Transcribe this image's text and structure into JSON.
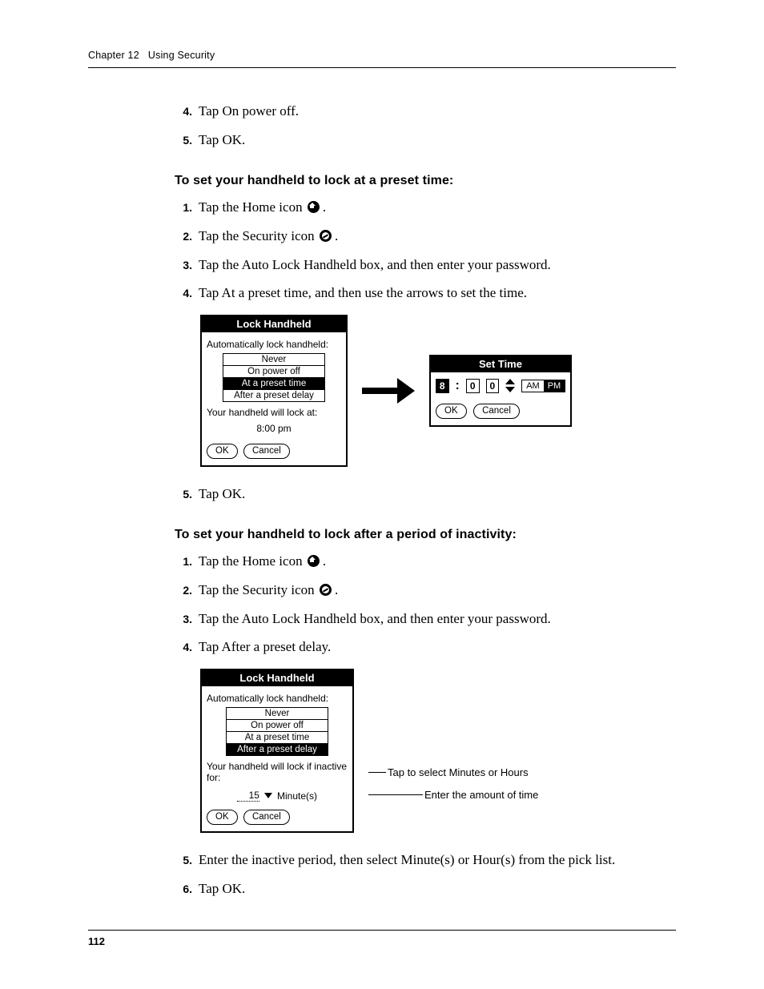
{
  "header": {
    "chapter": "Chapter 12",
    "title": "Using Security"
  },
  "page_number": "112",
  "intro_steps": [
    {
      "n": "4.",
      "t": "Tap On power off."
    },
    {
      "n": "5.",
      "t": "Tap OK."
    }
  ],
  "sectionA": {
    "heading": "To set your handheld to lock at a preset time:",
    "steps": [
      {
        "n": "1.",
        "pre": "Tap the Home icon ",
        "post": ".",
        "icon": "home"
      },
      {
        "n": "2.",
        "pre": "Tap the Security icon ",
        "post": ".",
        "icon": "security"
      },
      {
        "n": "3.",
        "t": "Tap the Auto Lock Handheld box, and then enter your password."
      },
      {
        "n": "4.",
        "t": "Tap At a preset time, and then use the arrows to set the time."
      }
    ],
    "figure": {
      "lock": {
        "title": "Lock Handheld",
        "label": "Automatically lock handheld:",
        "options": [
          "Never",
          "On power off",
          "At a preset time",
          "After a preset delay"
        ],
        "selected": "At a preset time",
        "lockat_label": "Your handheld will lock at:",
        "lockat_time": "8:00 pm",
        "ok": "OK",
        "cancel": "Cancel"
      },
      "settime": {
        "title": "Set Time",
        "hour": "8",
        "m1": "0",
        "m2": "0",
        "am": "AM",
        "pm": "PM",
        "ok": "OK",
        "cancel": "Cancel"
      }
    },
    "after_step": {
      "n": "5.",
      "t": "Tap OK."
    }
  },
  "sectionB": {
    "heading": "To set your handheld to lock after a period of inactivity:",
    "steps": [
      {
        "n": "1.",
        "pre": "Tap the Home icon ",
        "post": ".",
        "icon": "home"
      },
      {
        "n": "2.",
        "pre": "Tap the Security icon ",
        "post": ".",
        "icon": "security"
      },
      {
        "n": "3.",
        "t": "Tap the Auto Lock Handheld box, and then enter your password."
      },
      {
        "n": "4.",
        "t": "Tap After a preset delay."
      }
    ],
    "figure": {
      "lock": {
        "title": "Lock Handheld",
        "label": "Automatically lock handheld:",
        "options": [
          "Never",
          "On power off",
          "At a preset time",
          "After a preset delay"
        ],
        "selected": "After a preset delay",
        "inactive_label": "Your handheld will lock if inactive for:",
        "delay_value": "15",
        "delay_unit": "Minute(s)",
        "ok": "OK",
        "cancel": "Cancel"
      },
      "callout1": "Tap to select Minutes or Hours",
      "callout2": "Enter the amount of time"
    },
    "after_steps": [
      {
        "n": "5.",
        "t": "Enter the inactive period, then select Minute(s) or Hour(s) from the pick list."
      },
      {
        "n": "6.",
        "t": "Tap OK."
      }
    ]
  }
}
